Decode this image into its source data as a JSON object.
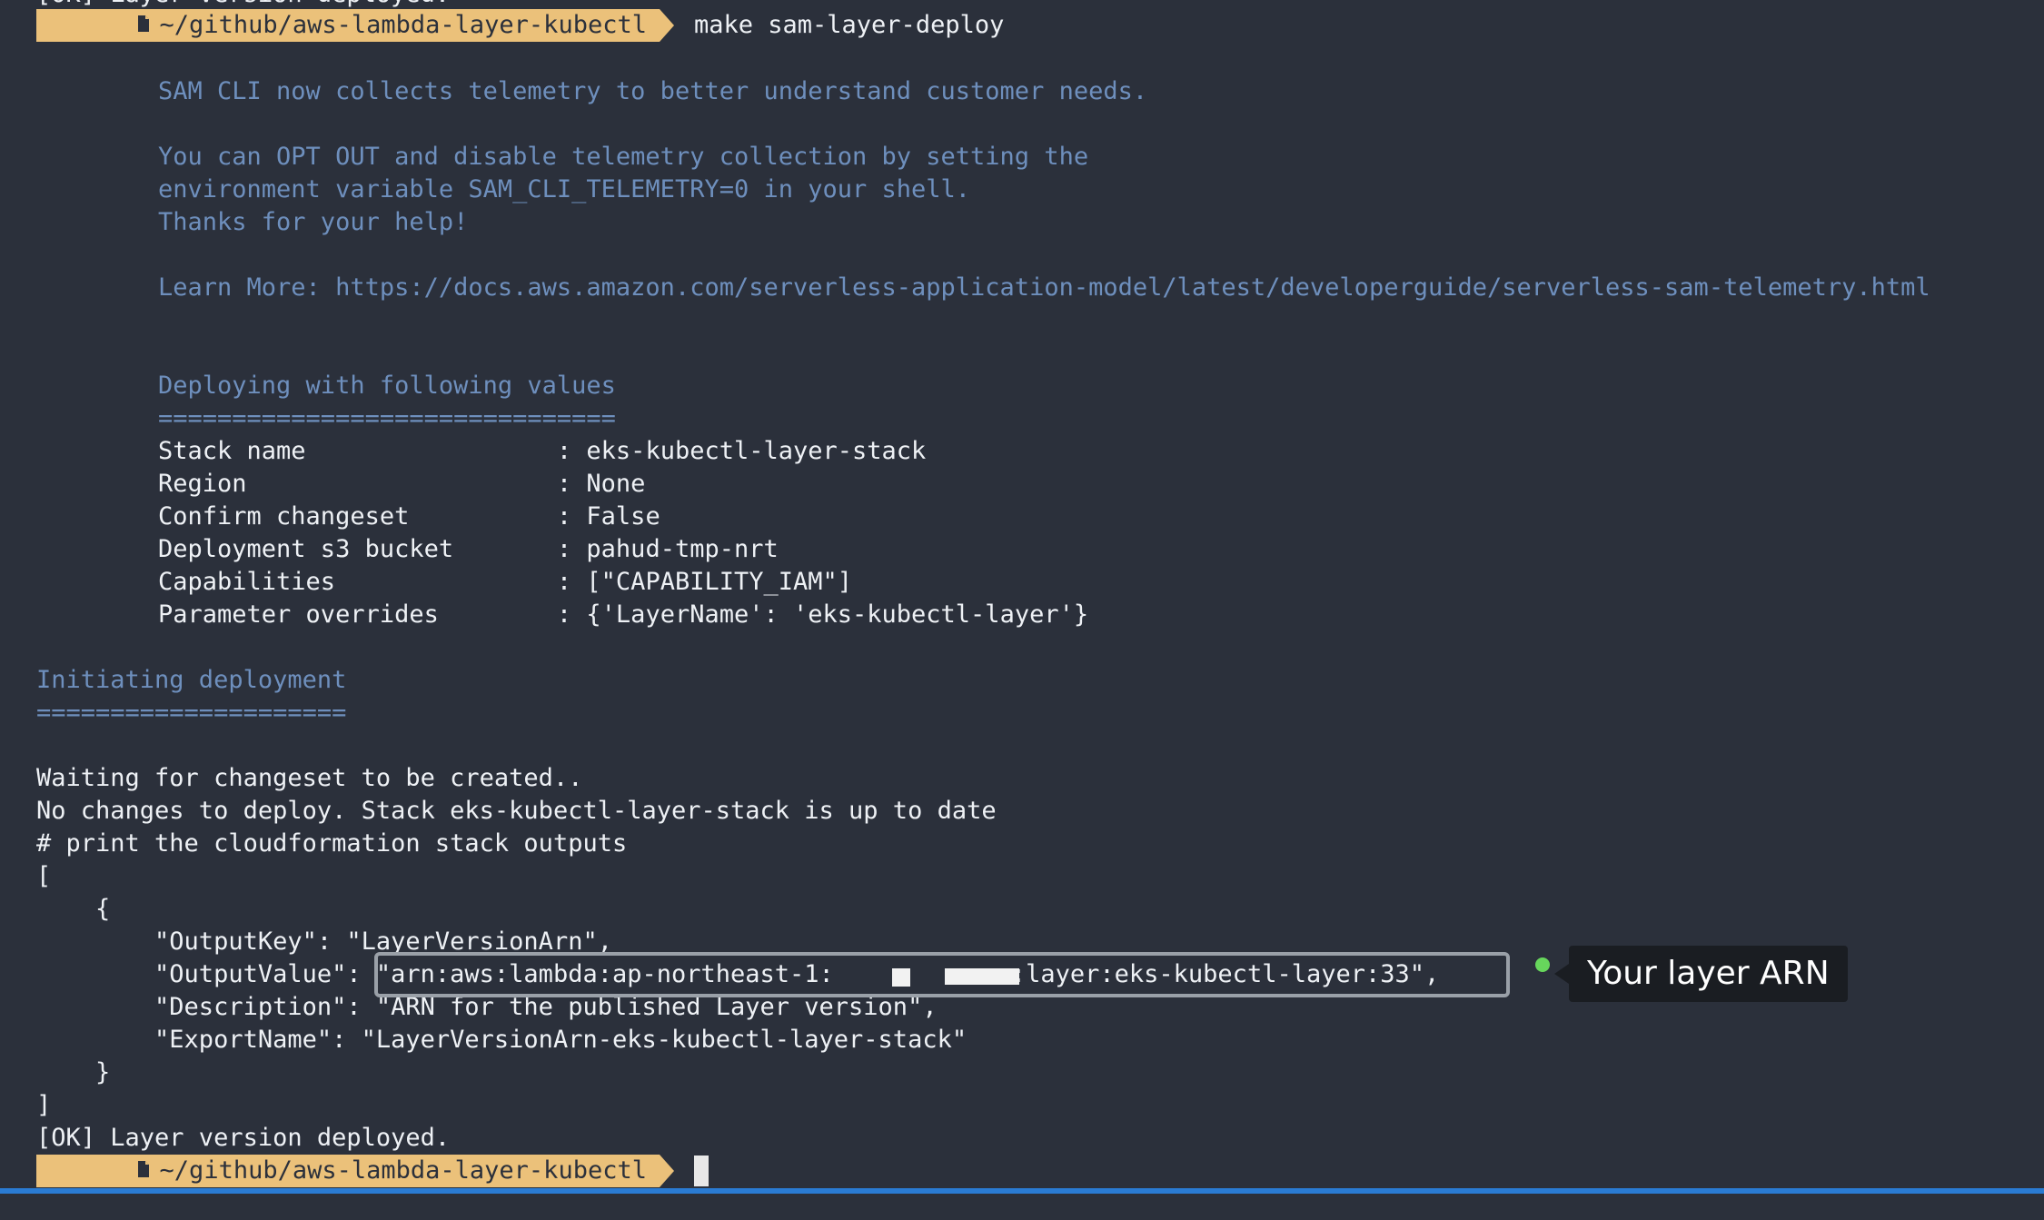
{
  "prompt": {
    "path": "~/github/aws-lambda-layer-kubectl",
    "command": "make sam-layer-deploy"
  },
  "top_partial": "[OK] Layer version deployed.",
  "telemetry": {
    "line1": "SAM CLI now collects telemetry to better understand customer needs.",
    "line2": "You can OPT OUT and disable telemetry collection by setting the",
    "line3": "environment variable SAM_CLI_TELEMETRY=0 in your shell.",
    "line4": "Thanks for your help!",
    "line5": "Learn More: https://docs.aws.amazon.com/serverless-application-model/latest/developerguide/serverless-sam-telemetry.html"
  },
  "deploy_values": {
    "heading": "Deploying with following values",
    "underline": "===============================",
    "rows": [
      {
        "key": "Stack name                 ",
        "value": ": eks-kubectl-layer-stack"
      },
      {
        "key": "Region                     ",
        "value": ": None"
      },
      {
        "key": "Confirm changeset          ",
        "value": ": False"
      },
      {
        "key": "Deployment s3 bucket       ",
        "value": ": pahud-tmp-nrt"
      },
      {
        "key": "Capabilities               ",
        "value": ": [\"CAPABILITY_IAM\"]"
      },
      {
        "key": "Parameter overrides        ",
        "value": ": {'LayerName': 'eks-kubectl-layer'}"
      }
    ]
  },
  "initiating": {
    "heading": "Initiating deployment",
    "underline": "====================="
  },
  "log": {
    "waiting": "Waiting for changeset to be created..",
    "nochanges": "No changes to deploy. Stack eks-kubectl-layer-stack is up to date",
    "comment": "# print the cloudformation stack outputs",
    "open_bracket": "[",
    "open_brace": "    {",
    "output_key": "        \"OutputKey\": \"LayerVersionArn\",",
    "output_value_label": "        \"OutputValue\": ",
    "output_value": "\"arn:aws:lambda:ap-northeast-1:            :layer:eks-kubectl-layer:33\",",
    "description": "        \"Description\": \"ARN for the published Layer version\",",
    "export_name": "        \"ExportName\": \"LayerVersionArn-eks-kubectl-layer-stack\"",
    "close_brace": "    }",
    "close_bracket": "]",
    "ok": "[OK] Layer version deployed."
  },
  "callout": {
    "label": "Your layer ARN"
  },
  "colors": {
    "background": "#2b303b",
    "prompt_bg": "#ebc17a",
    "dim_text": "#6e8fbd",
    "callout_dot": "#67d65c"
  }
}
